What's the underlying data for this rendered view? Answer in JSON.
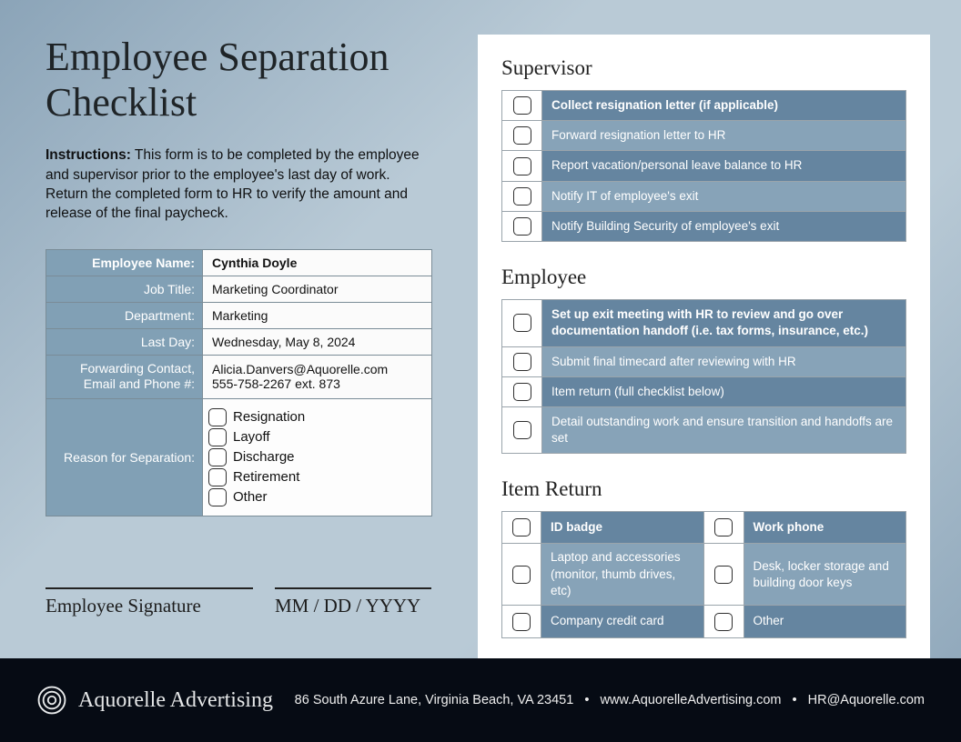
{
  "title": "Employee Separation Checklist",
  "instructions_label": "Instructions:",
  "instructions_text": "This form is to be completed by the employee and supervisor prior to the employee's last day of work. Return the completed form to HR to verify the amount and release of the final paycheck.",
  "info": {
    "rows": [
      {
        "label": "Employee Name:",
        "value": "Cynthia Doyle"
      },
      {
        "label": "Job Title:",
        "value": "Marketing Coordinator"
      },
      {
        "label": "Department:",
        "value": "Marketing"
      },
      {
        "label": "Last Day:",
        "value": "Wednesday, May 8, 2024"
      }
    ],
    "forwarding_label": "Forwarding Contact, Email and Phone #:",
    "forwarding_email": "Alicia.Danvers@Aquorelle.com",
    "forwarding_phone": "555-758-2267 ext. 873",
    "reason_label": "Reason for Separation:",
    "reasons": [
      "Resignation",
      "Layoff",
      "Discharge",
      "Retirement",
      "Other"
    ]
  },
  "signature": {
    "emp": "Employee Signature",
    "date": "MM / DD / YYYY"
  },
  "colors": {
    "dark": "#6585a0",
    "light": "#87a3b8"
  },
  "sections": {
    "supervisor": {
      "title": "Supervisor",
      "items": [
        {
          "text": "Collect resignation letter (if applicable)",
          "bold": true,
          "shade": "dark"
        },
        {
          "text": "Forward resignation letter to HR",
          "bold": false,
          "shade": "light"
        },
        {
          "text": "Report vacation/personal leave balance to HR",
          "bold": false,
          "shade": "dark"
        },
        {
          "text": "Notify IT of employee's exit",
          "bold": false,
          "shade": "light"
        },
        {
          "text": "Notify Building Security of employee's exit",
          "bold": false,
          "shade": "dark"
        }
      ]
    },
    "employee": {
      "title": "Employee",
      "items": [
        {
          "text": "Set up exit meeting with HR to review and go over documentation handoff (i.e. tax forms, insurance, etc.)",
          "bold": true,
          "shade": "dark"
        },
        {
          "text": "Submit final timecard after reviewing with HR",
          "bold": false,
          "shade": "light"
        },
        {
          "text": "Item return (full checklist below)",
          "bold": false,
          "shade": "dark"
        },
        {
          "text": "Detail outstanding work and ensure transition and handoffs are set",
          "bold": false,
          "shade": "light"
        }
      ]
    },
    "item_return": {
      "title": "Item Return",
      "items": [
        {
          "text": "ID badge",
          "bold": true,
          "shade": "dark"
        },
        {
          "text": "Work phone",
          "bold": true,
          "shade": "dark"
        },
        {
          "text": "Laptop and accessories (monitor, thumb drives, etc)",
          "bold": false,
          "shade": "light"
        },
        {
          "text": "Desk, locker storage and building door keys",
          "bold": false,
          "shade": "light"
        },
        {
          "text": "Company credit card",
          "bold": false,
          "shade": "dark"
        },
        {
          "text": "Other",
          "bold": false,
          "shade": "dark"
        }
      ]
    }
  },
  "footer": {
    "brand": "Aquorelle Advertising",
    "address": "86 South Azure Lane, Virginia Beach, VA 23451",
    "web": "www.AquorelleAdvertising.com",
    "email": "HR@Aquorelle.com",
    "sep": "•"
  }
}
